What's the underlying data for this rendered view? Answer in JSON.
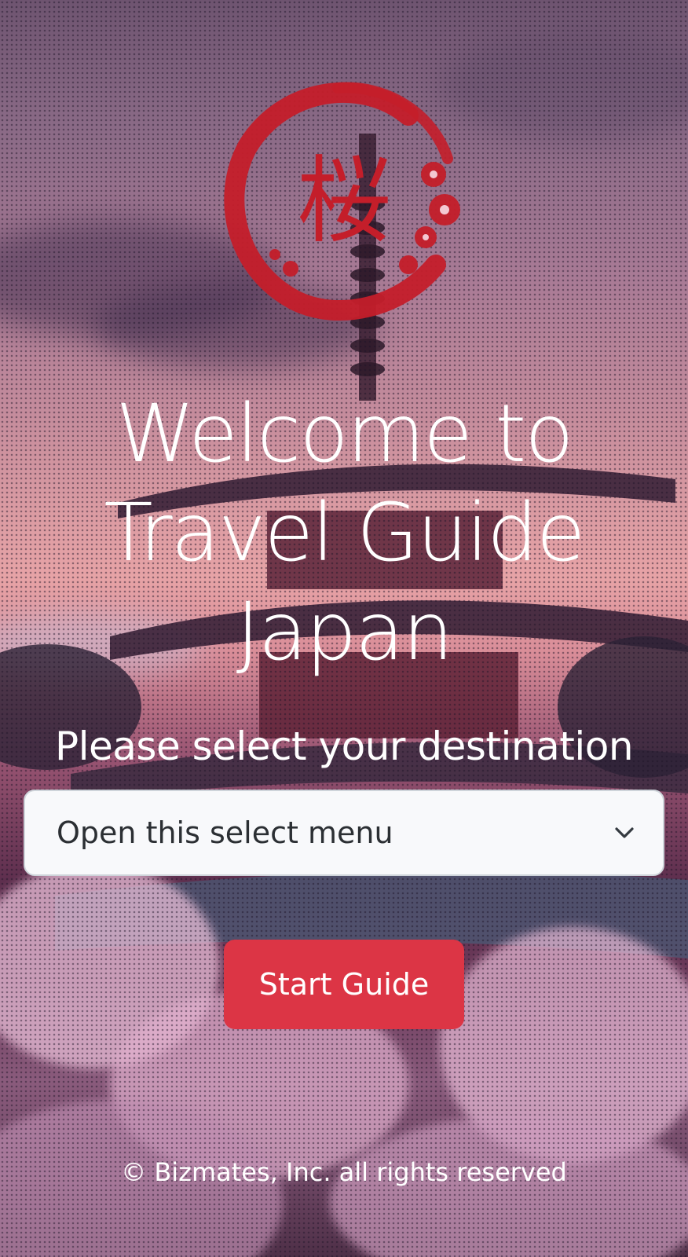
{
  "hero": {
    "title_line1": "Welcome to",
    "title_line2": "Travel Guide",
    "title_line3": "Japan",
    "subtitle": "Please select your destination"
  },
  "logo": {
    "kanji": "桜",
    "icon": "sakura-enso-logo",
    "color": "#c41e2a"
  },
  "destination_select": {
    "selected": "Open this select menu",
    "icon": "chevron-down-icon"
  },
  "start_button": {
    "label": "Start Guide",
    "color": "#dc3545"
  },
  "footer": {
    "copyright": "© Bizmates, Inc. all rights reserved"
  }
}
